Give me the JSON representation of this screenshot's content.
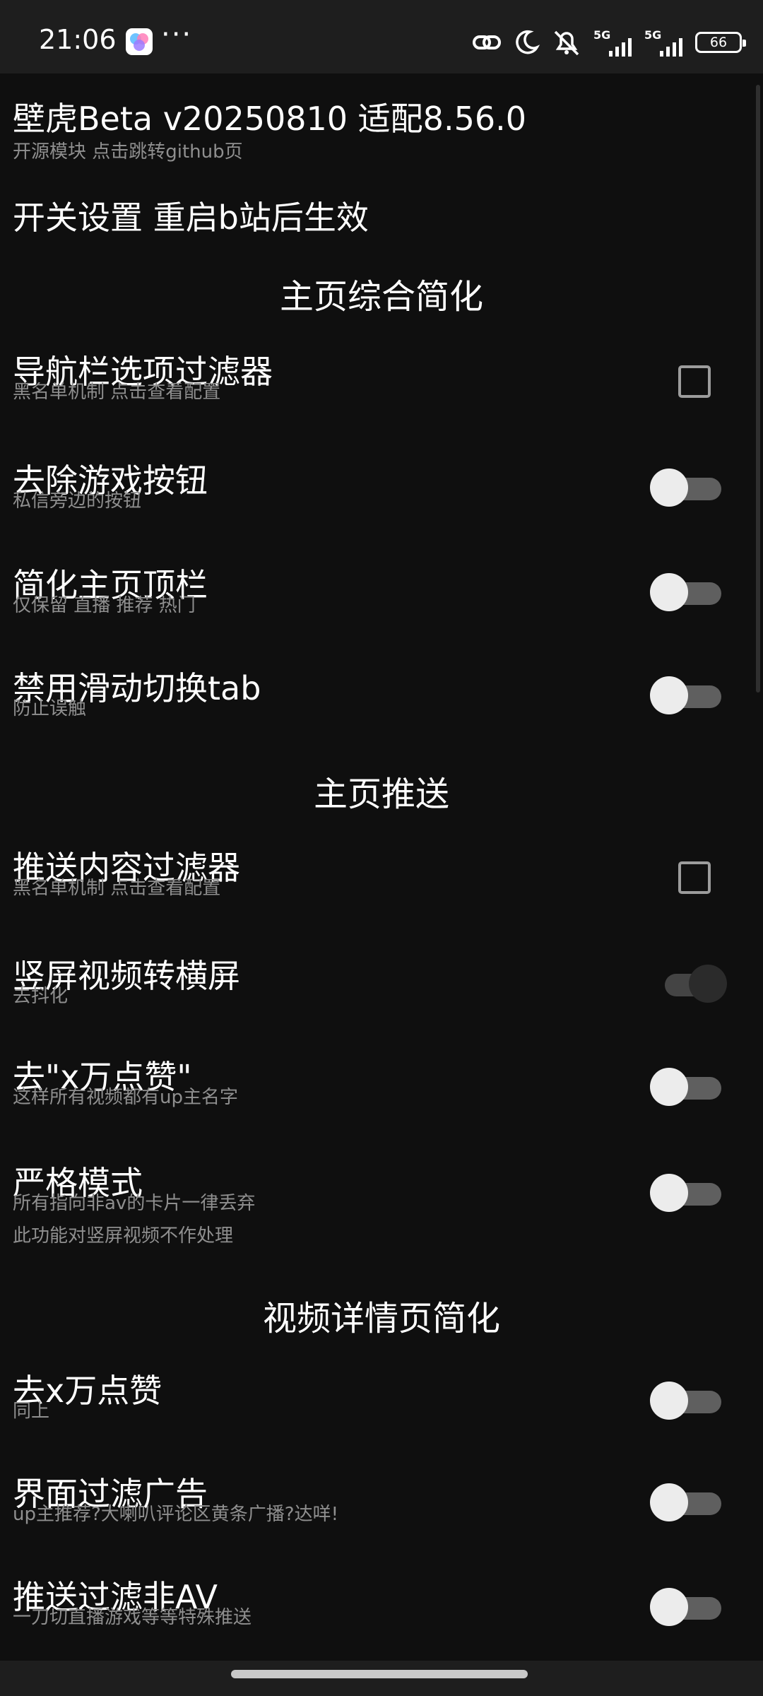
{
  "status_bar": {
    "time": "21:06",
    "more": "···",
    "signal1_label": "5G",
    "signal2_label": "5G",
    "battery": "66",
    "icons": [
      "link-icon",
      "moon-icon",
      "alarm-off-icon",
      "signal-5g-icon",
      "signal-5g-icon",
      "battery-icon"
    ]
  },
  "header": {
    "title": "壁虎Beta v20250810 适配8.56.0",
    "subtitle": "开源模块 点击跳转github页"
  },
  "notice": "开关设置 重启b站后生效",
  "sections": {
    "home": "主页综合简化",
    "feed": "主页推送",
    "video": "视频详情页简化"
  },
  "items": {
    "nav_filter": {
      "title": "导航栏选项过滤器",
      "sub": "黑名单机制 点击查看配置",
      "control": "checkbox",
      "checked": false
    },
    "remove_game": {
      "title": "去除游戏按钮",
      "sub": "私信旁边的按钮",
      "control": "switch",
      "on": false
    },
    "simplify_topbar": {
      "title": "简化主页顶栏",
      "sub": "仅保留 直播 推荐 热门",
      "control": "switch",
      "on": false
    },
    "disable_swipe": {
      "title": "禁用滑动切换tab",
      "sub": "防止误触",
      "control": "switch",
      "on": false
    },
    "feed_filter": {
      "title": "推送内容过滤器",
      "sub": "黑名单机制 点击查看配置",
      "control": "checkbox",
      "checked": false
    },
    "vertical_to_horizontal": {
      "title": "竖屏视频转横屏",
      "sub": "去抖化",
      "control": "switch",
      "on": true
    },
    "remove_likes": {
      "title": "去\"x万点赞\"",
      "sub": "这样所有视频都有up主名字",
      "control": "switch",
      "on": false
    },
    "strict_mode": {
      "title": "严格模式",
      "sub1": "所有指向非av的卡片一律丢弃",
      "sub2": "此功能对竖屏视频不作处理",
      "control": "switch",
      "on": false
    },
    "detail_remove_likes": {
      "title": "去x万点赞",
      "sub": "同上",
      "control": "switch",
      "on": false
    },
    "detail_filter_ads": {
      "title": "界面过滤广告",
      "sub": "up主推荐?大喇叭评论区黄条广播?达咩!",
      "control": "switch",
      "on": false
    },
    "feed_filter_non_av": {
      "title": "推送过滤非AV",
      "sub": "一刀切直播游戏等等特殊推送",
      "control": "switch",
      "on": false
    }
  }
}
